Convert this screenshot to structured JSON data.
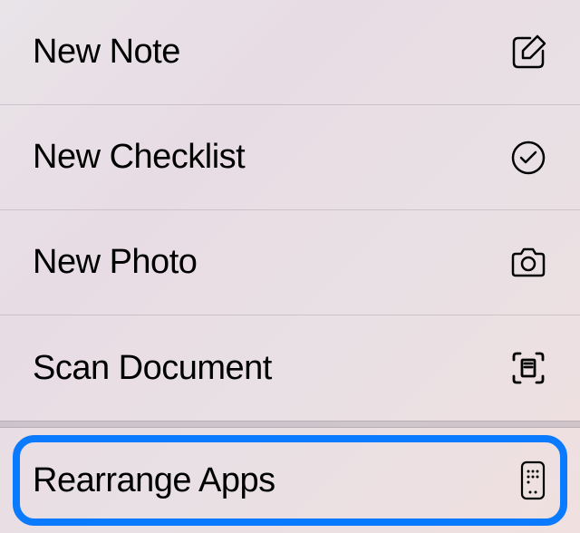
{
  "menu": {
    "items": [
      {
        "label": "New Note",
        "icon": "compose-icon"
      },
      {
        "label": "New Checklist",
        "icon": "checkmark-circle-icon"
      },
      {
        "label": "New Photo",
        "icon": "camera-icon"
      },
      {
        "label": "Scan Document",
        "icon": "scan-document-icon"
      }
    ],
    "secondary": [
      {
        "label": "Rearrange Apps",
        "icon": "apps-icon",
        "highlighted": true
      }
    ]
  },
  "colors": {
    "highlight": "#0a7aff"
  }
}
